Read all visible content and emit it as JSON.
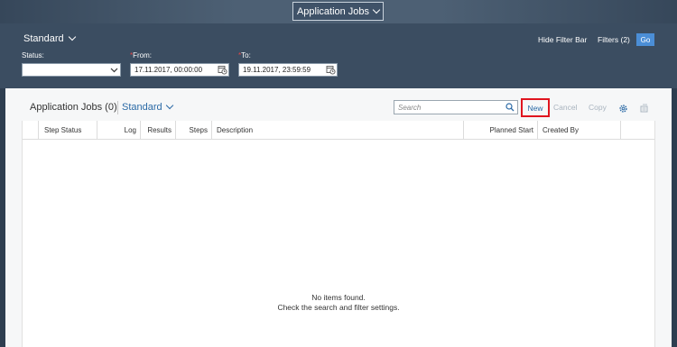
{
  "shell": {
    "app_title": "Application Jobs"
  },
  "filter_bar": {
    "variant": "Standard",
    "hide_filter_bar": "Hide Filter Bar",
    "filters": "Filters (2)",
    "go": "Go",
    "status": {
      "label": "Status:",
      "value": ""
    },
    "from": {
      "required_mark": "*",
      "label": "From:",
      "value": "17.11.2017, 00:00:00"
    },
    "to": {
      "required_mark": "*",
      "label": "To:",
      "value": "19.11.2017, 23:59:59"
    }
  },
  "table_toolbar": {
    "title": "Application Jobs (0)",
    "variant": "Standard",
    "search_placeholder": "Search",
    "new": "New",
    "cancel": "Cancel",
    "copy": "Copy",
    "icons": [
      "gear-icon",
      "export-icon"
    ]
  },
  "table": {
    "columns": [
      "Step Status",
      "Log",
      "Results",
      "Steps",
      "Description",
      "Planned Start",
      "Created By"
    ],
    "rows": [],
    "empty_line1": "No items found.",
    "empty_line2": "Check the search and filter settings."
  },
  "colors": {
    "shell_bg": "#4d6074",
    "filter_bar_bg": "#3b4d61",
    "go_button": "#4b8ed6",
    "link_blue": "#2b6aa6",
    "highlight_red": "#e0151f",
    "required_red": "#e04646"
  }
}
